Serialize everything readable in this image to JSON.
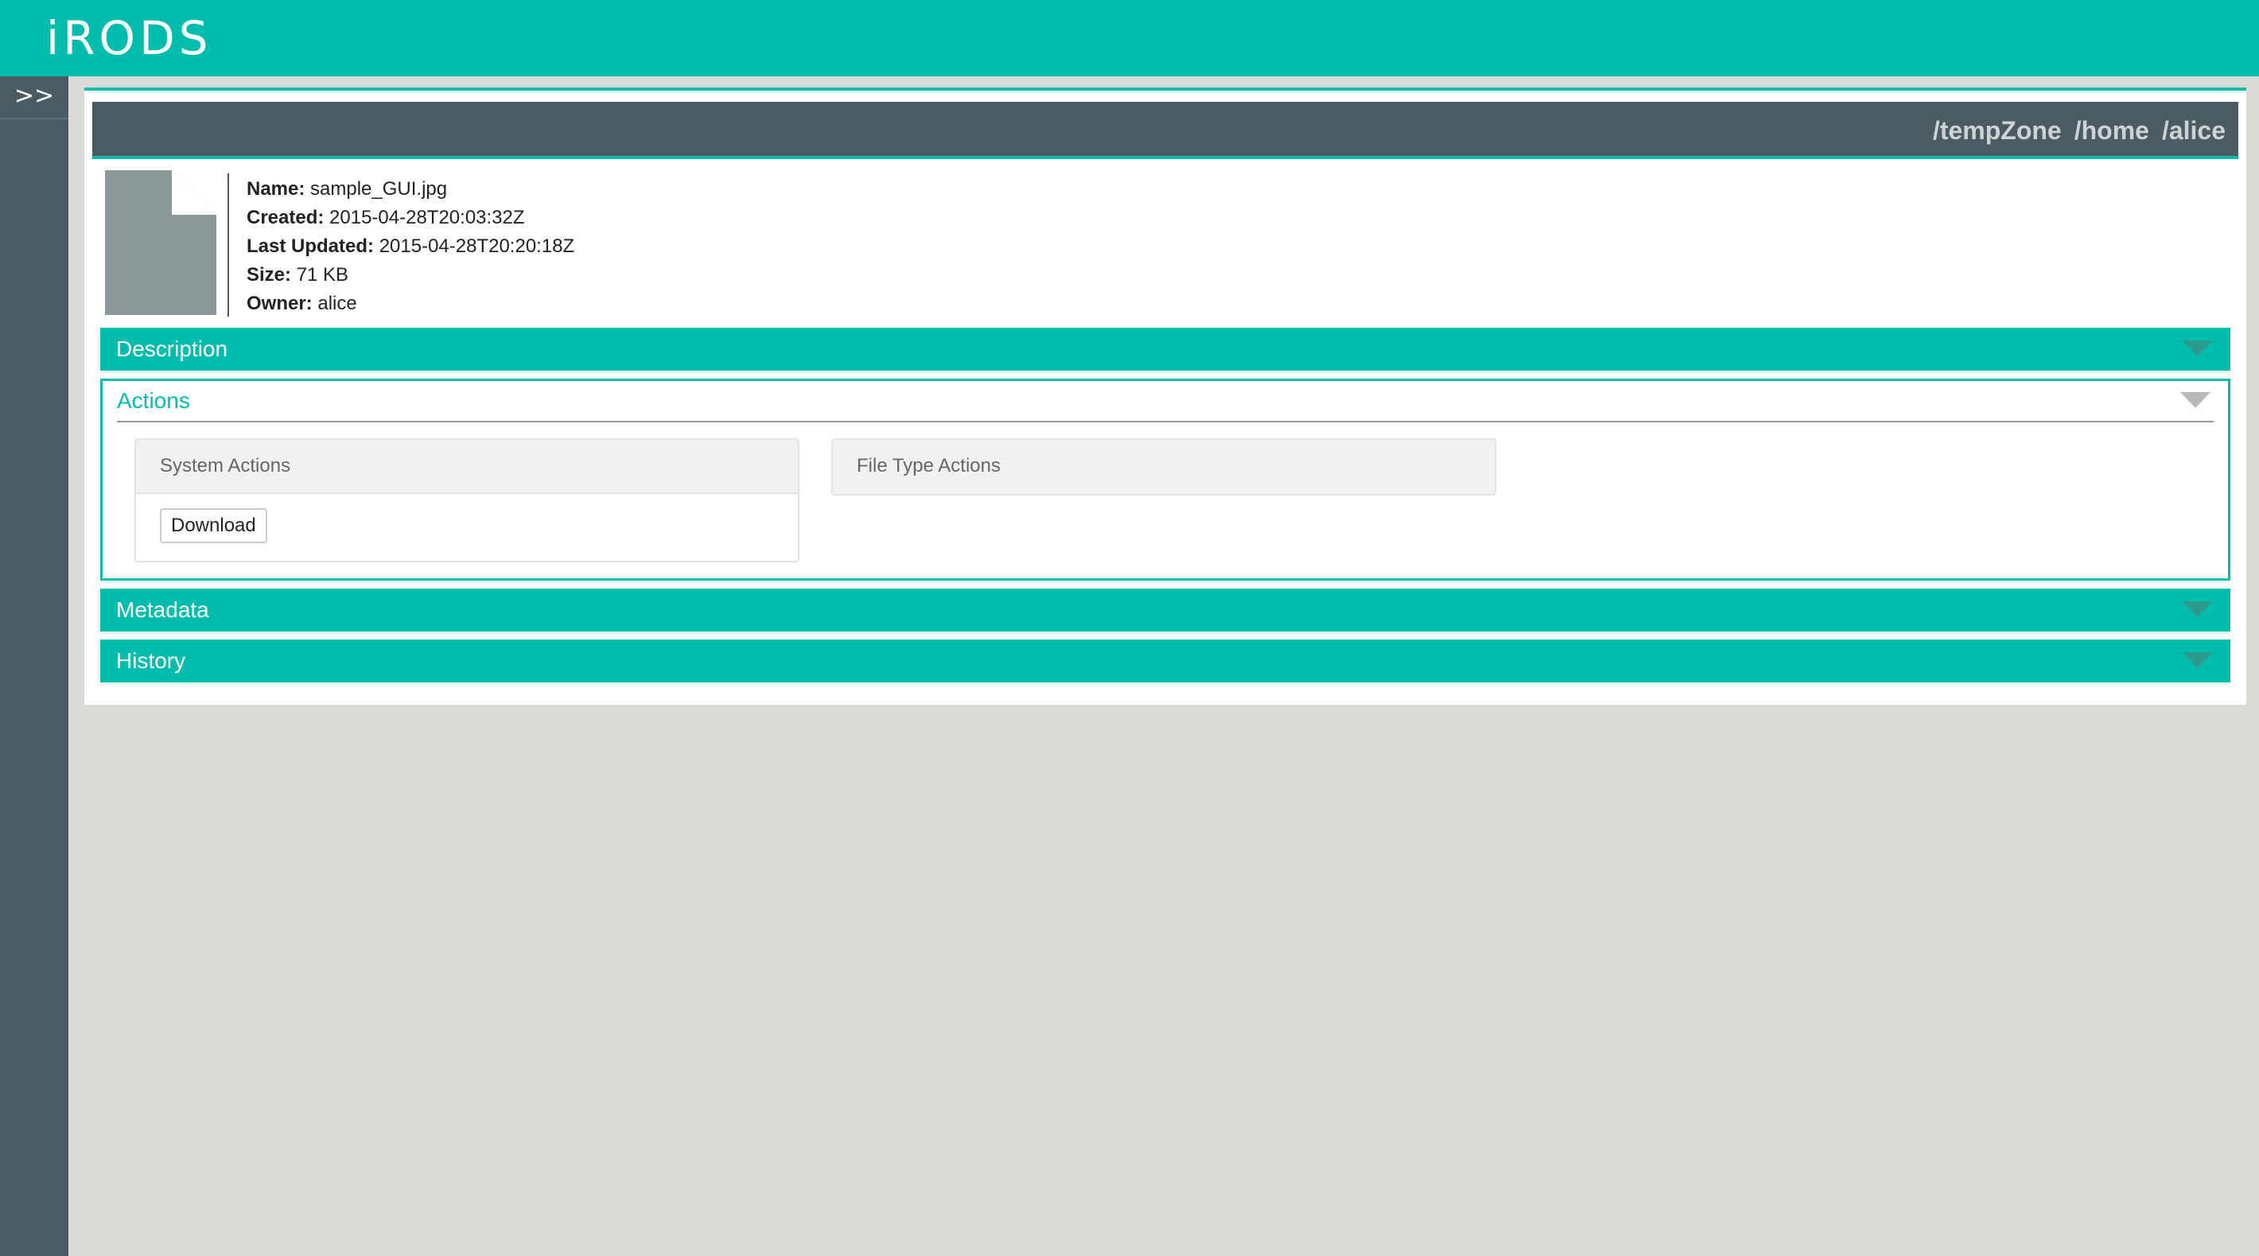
{
  "header": {
    "logo_text": "iRODS"
  },
  "sidebar": {
    "toggle_label": ">>"
  },
  "breadcrumb": {
    "items": [
      "/tempZone",
      "/home",
      "/alice"
    ]
  },
  "file": {
    "icon": "document-icon",
    "name_label": "Name:",
    "name_value": "sample_GUI.jpg",
    "created_label": "Created:",
    "created_value": "2015-04-28T20:03:32Z",
    "updated_label": "Last Updated:",
    "updated_value": "2015-04-28T20:20:18Z",
    "size_label": "Size:",
    "size_value": "71 KB",
    "owner_label": "Owner:",
    "owner_value": "alice"
  },
  "sections": {
    "description": "Description",
    "actions": "Actions",
    "metadata": "Metadata",
    "history": "History"
  },
  "actions": {
    "system_actions_title": "System Actions",
    "download_label": "Download",
    "file_type_actions_title": "File Type Actions"
  },
  "colors": {
    "accent": "#00bcab",
    "sidebar": "#4a5b62",
    "background": "#d9dad5"
  }
}
